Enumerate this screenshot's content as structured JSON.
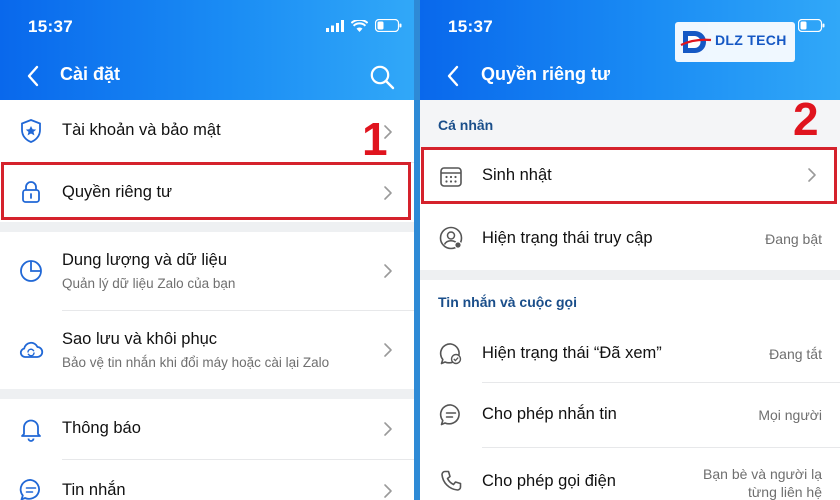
{
  "left": {
    "status_time": "15:37",
    "title": "Cài đặt",
    "items": [
      {
        "label": "Tài khoản và bảo mật",
        "sub": ""
      },
      {
        "label": "Quyền riêng tư",
        "sub": ""
      },
      {
        "label": "Dung lượng và dữ liệu",
        "sub": "Quản lý dữ liệu Zalo của bạn"
      },
      {
        "label": "Sao lưu và khôi phục",
        "sub": "Bảo vệ tin nhắn khi đổi máy hoặc cài lại Zalo"
      },
      {
        "label": "Thông báo",
        "sub": ""
      },
      {
        "label": "Tin nhắn",
        "sub": ""
      }
    ],
    "step_number": "1"
  },
  "right": {
    "status_time": "15:37",
    "title": "Quyền riêng tư",
    "logo_text": "DLZ TECH",
    "section_personal": "Cá nhân",
    "section_messages": "Tin nhắn và cuộc gọi",
    "items": [
      {
        "label": "Sinh nhật",
        "value": ""
      },
      {
        "label": "Hiện trạng thái truy cập",
        "value": "Đang bật"
      },
      {
        "label": "Hiện trạng thái “Đã xem”",
        "value": "Đang tắt"
      },
      {
        "label": "Cho phép nhắn tin",
        "value": "Mọi người"
      },
      {
        "label": "Cho phép gọi điện",
        "value_line1": "Bạn bè và người lạ",
        "value_line2": "từng liên hệ"
      }
    ],
    "step_number": "2"
  },
  "colors": {
    "header_start": "#0968ec",
    "header_end": "#31a8f8",
    "highlight": "#d5222c",
    "section_title": "#1a4e8a"
  },
  "icons": [
    "signal-icon",
    "wifi-icon",
    "battery-icon",
    "back-icon",
    "search-icon",
    "shield-icon",
    "lock-icon",
    "pie-chart-icon",
    "cloud-sync-icon",
    "bell-icon",
    "chat-icon",
    "calendar-icon",
    "user-status-icon",
    "seen-icon",
    "message-icon",
    "phone-icon",
    "chevron-right-icon"
  ]
}
